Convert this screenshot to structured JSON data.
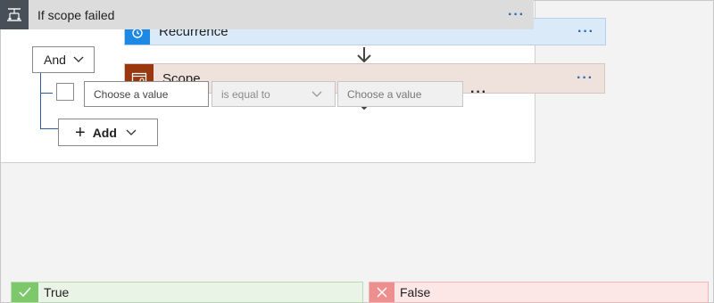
{
  "steps": {
    "recurrence": {
      "title": "Recurrence",
      "more": "···",
      "icon": "alarm-clock-icon"
    },
    "scope": {
      "title": "Scope",
      "more": "···",
      "icon": "scope-icon"
    }
  },
  "condition": {
    "title": "If scope failed",
    "more": "···",
    "icon": "condition-icon",
    "group_operator": "And",
    "row": {
      "left_placeholder": "Choose a value",
      "operator": "is equal to",
      "right_placeholder": "Choose a value",
      "more": "···"
    },
    "add_label": "Add"
  },
  "branches": {
    "true_label": "True",
    "false_label": "False"
  },
  "colors": {
    "recurrence_accent": "#1e88e5",
    "scope_accent": "#993711",
    "condition_accent": "#484f58",
    "true_accent": "#7dc86a",
    "false_accent": "#ee8f8f",
    "link_blue": "#2b6cb0"
  }
}
